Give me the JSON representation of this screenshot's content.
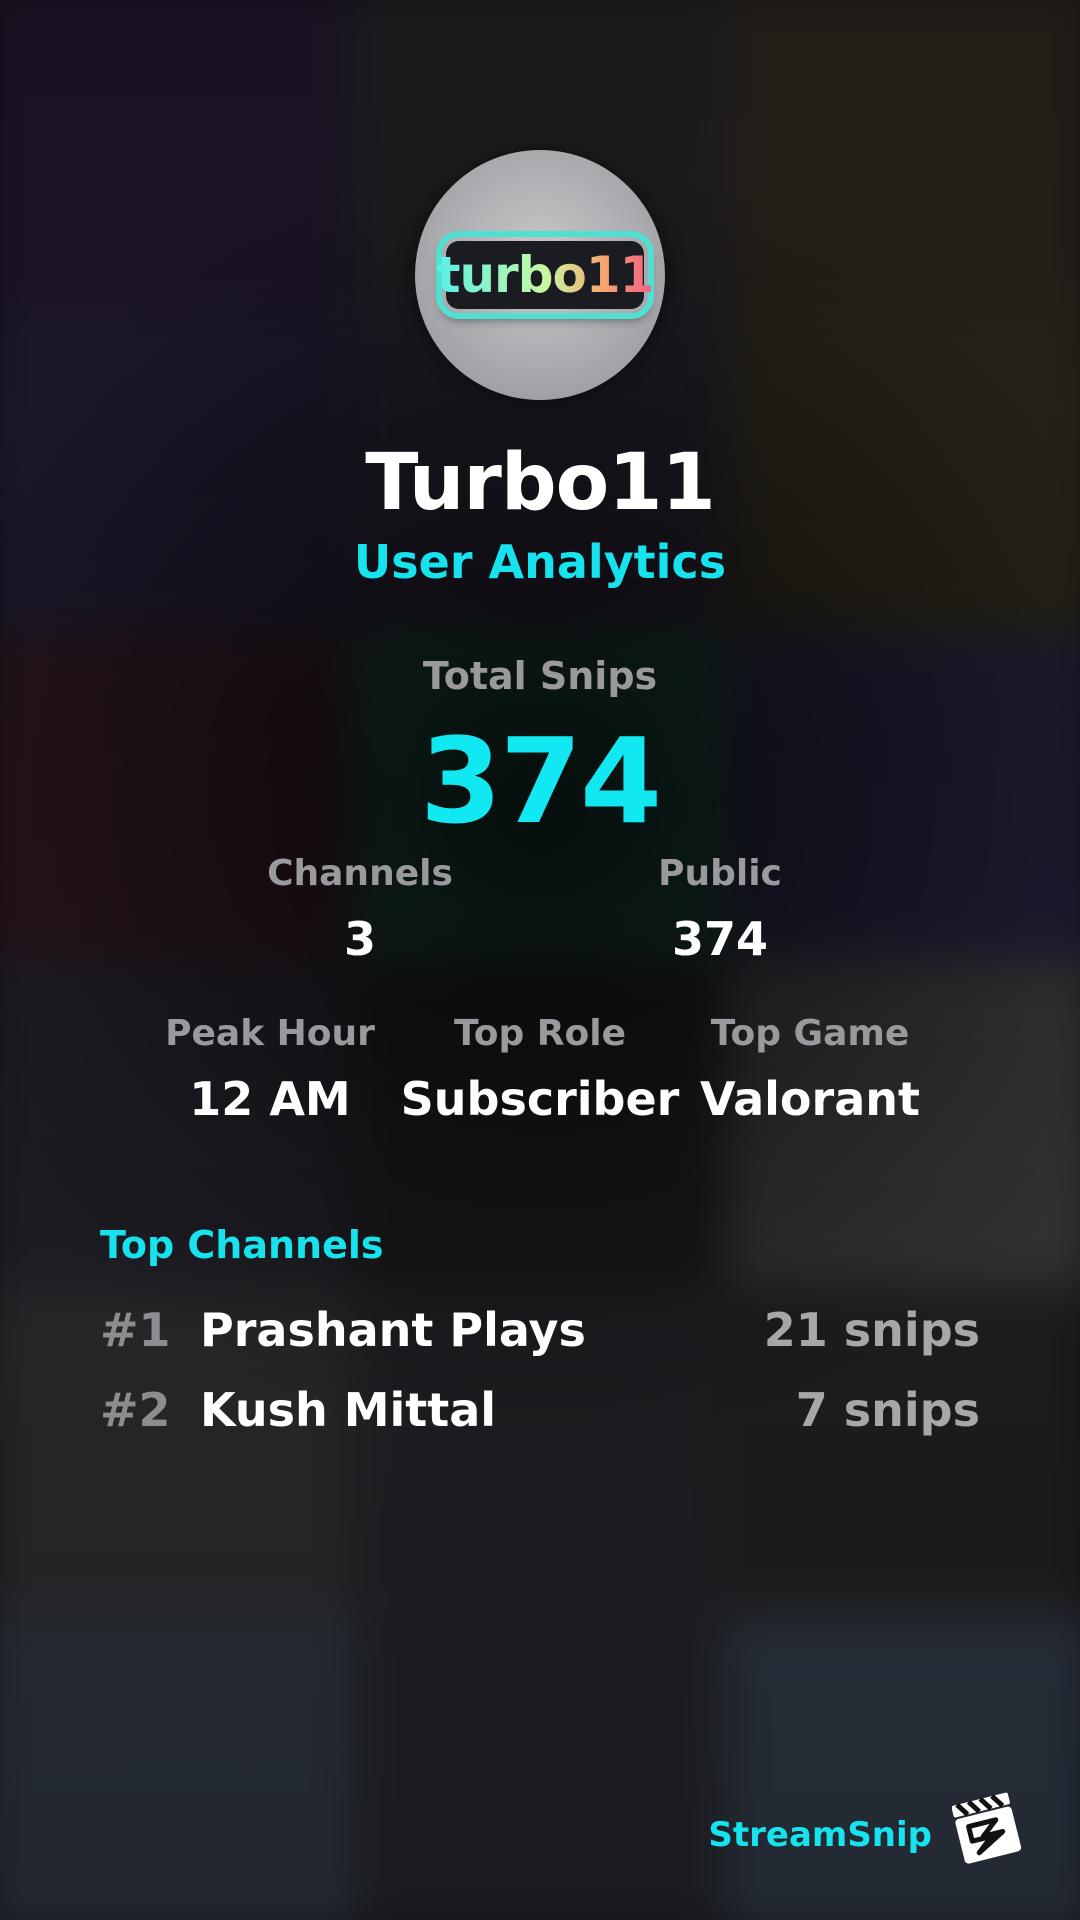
{
  "profile": {
    "logo_text": "turbo11",
    "username": "Turbo11",
    "subtitle": "User Analytics"
  },
  "totals": {
    "total_snips_label": "Total Snips",
    "total_snips_value": "374"
  },
  "stats_row1": [
    {
      "label": "Channels",
      "value": "3"
    },
    {
      "label": "Public",
      "value": "374"
    }
  ],
  "stats_row2": [
    {
      "label": "Peak Hour",
      "value": "12 AM"
    },
    {
      "label": "Top Role",
      "value": "Subscriber"
    },
    {
      "label": "Top Game",
      "value": "Valorant"
    }
  ],
  "top_channels": {
    "title": "Top Channels",
    "items": [
      {
        "rank": "#1",
        "name": "Prashant Plays",
        "count": "21 snips"
      },
      {
        "rank": "#2",
        "name": "Kush Mittal",
        "count": "7 snips"
      }
    ]
  },
  "brand": {
    "name": "StreamSnip",
    "icon": "clapperboard-icon"
  },
  "colors": {
    "accent": "#16e3ee",
    "label_gray": "#9a9a9e",
    "text": "#ffffff"
  }
}
